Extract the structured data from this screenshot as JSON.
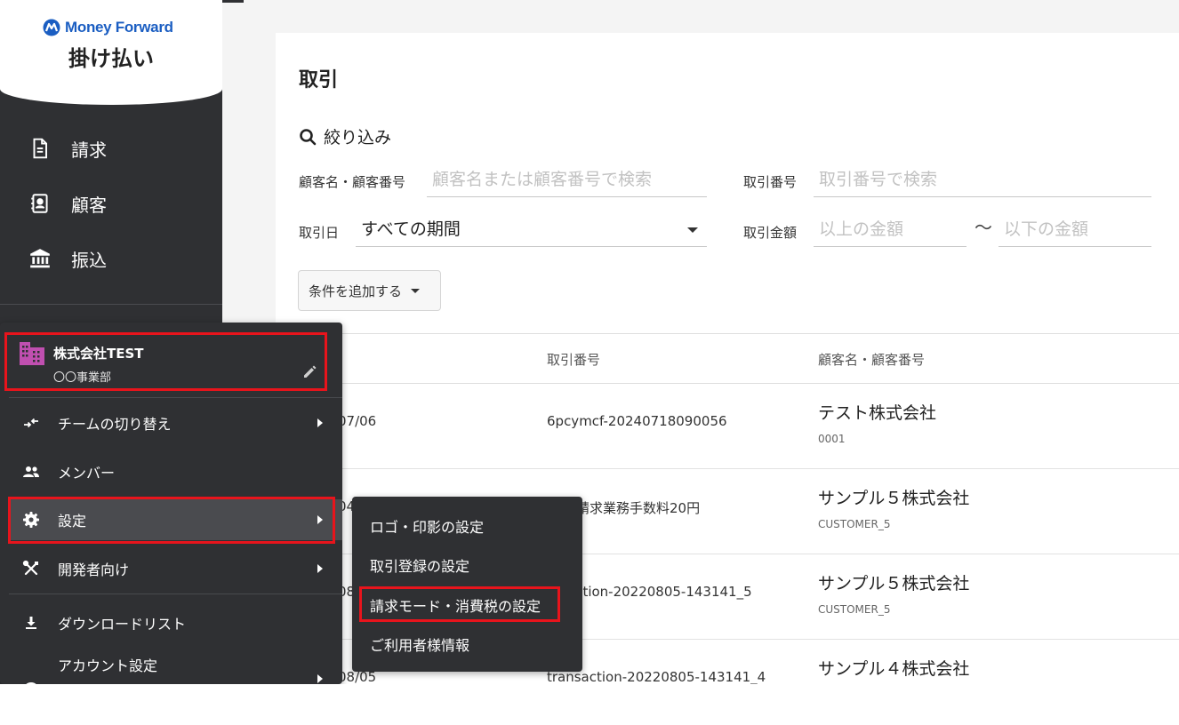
{
  "brand": {
    "logo_text": "Money Forward",
    "product_name": "掛け払い",
    "logo_color": "#1b5ec2"
  },
  "sidebar": {
    "items": [
      {
        "label": "請求",
        "icon": "document-icon"
      },
      {
        "label": "顧客",
        "icon": "contact-card-icon"
      },
      {
        "label": "振込",
        "icon": "bank-icon"
      }
    ]
  },
  "main": {
    "title": "取引",
    "filter": {
      "heading": "絞り込み",
      "customer_label": "顧客名・顧客番号",
      "customer_placeholder": "顧客名または顧客番号で検索",
      "transaction_no_label": "取引番号",
      "transaction_no_placeholder": "取引番号で検索",
      "date_label": "取引日",
      "date_value": "すべての期間",
      "amount_label": "取引金額",
      "amount_min_placeholder": "以上の金額",
      "amount_separator": "〜",
      "amount_max_placeholder": "以下の金額",
      "add_condition": "条件を追加する"
    },
    "table": {
      "headers": {
        "transaction_no": "取引番号",
        "customer": "顧客名・顧客番号"
      },
      "rows": [
        {
          "date": "07/06",
          "transaction_no": "6pcymcf-20240718090056",
          "customer_name": "テスト株式会社",
          "customer_no": "0001"
        },
        {
          "date": "04",
          "transaction_no": "請求業務手数料20円",
          "customer_name": "サンプル５株式会社",
          "customer_no": "CUSTOMER_5"
        },
        {
          "date": "08",
          "transaction_no": "action-20220805-143141_5",
          "customer_name": "サンプル５株式会社",
          "customer_no": "CUSTOMER_5"
        },
        {
          "date": "08/05",
          "transaction_no": "transaction-20220805-143141_4",
          "customer_name": "サンプル４株式会社",
          "customer_no": ""
        }
      ]
    }
  },
  "account_menu": {
    "team": {
      "name": "株式会社TEST",
      "department": "〇〇事業部",
      "icon": "building-icon",
      "icon_color": "#c04fb0"
    },
    "items": [
      {
        "label": "チームの切り替え",
        "icon": "switch-arrows-icon",
        "has_submenu": true
      },
      {
        "label": "メンバー",
        "icon": "people-icon",
        "has_submenu": false
      },
      {
        "label": "設定",
        "icon": "gear-icon",
        "has_submenu": true
      },
      {
        "label": "開発者向け",
        "icon": "tools-icon",
        "has_submenu": true
      },
      {
        "label": "ダウンロードリスト",
        "icon": "download-icon",
        "has_submenu": false
      },
      {
        "label": "アカウント設定",
        "icon": "account-icon",
        "has_submenu": true
      }
    ]
  },
  "settings_submenu": {
    "items": [
      {
        "label": "ロゴ・印影の設定"
      },
      {
        "label": "取引登録の設定"
      },
      {
        "label": "請求モード・消費税の設定"
      },
      {
        "label": "ご利用者様情報"
      }
    ]
  },
  "highlight_color": "#e8141c"
}
